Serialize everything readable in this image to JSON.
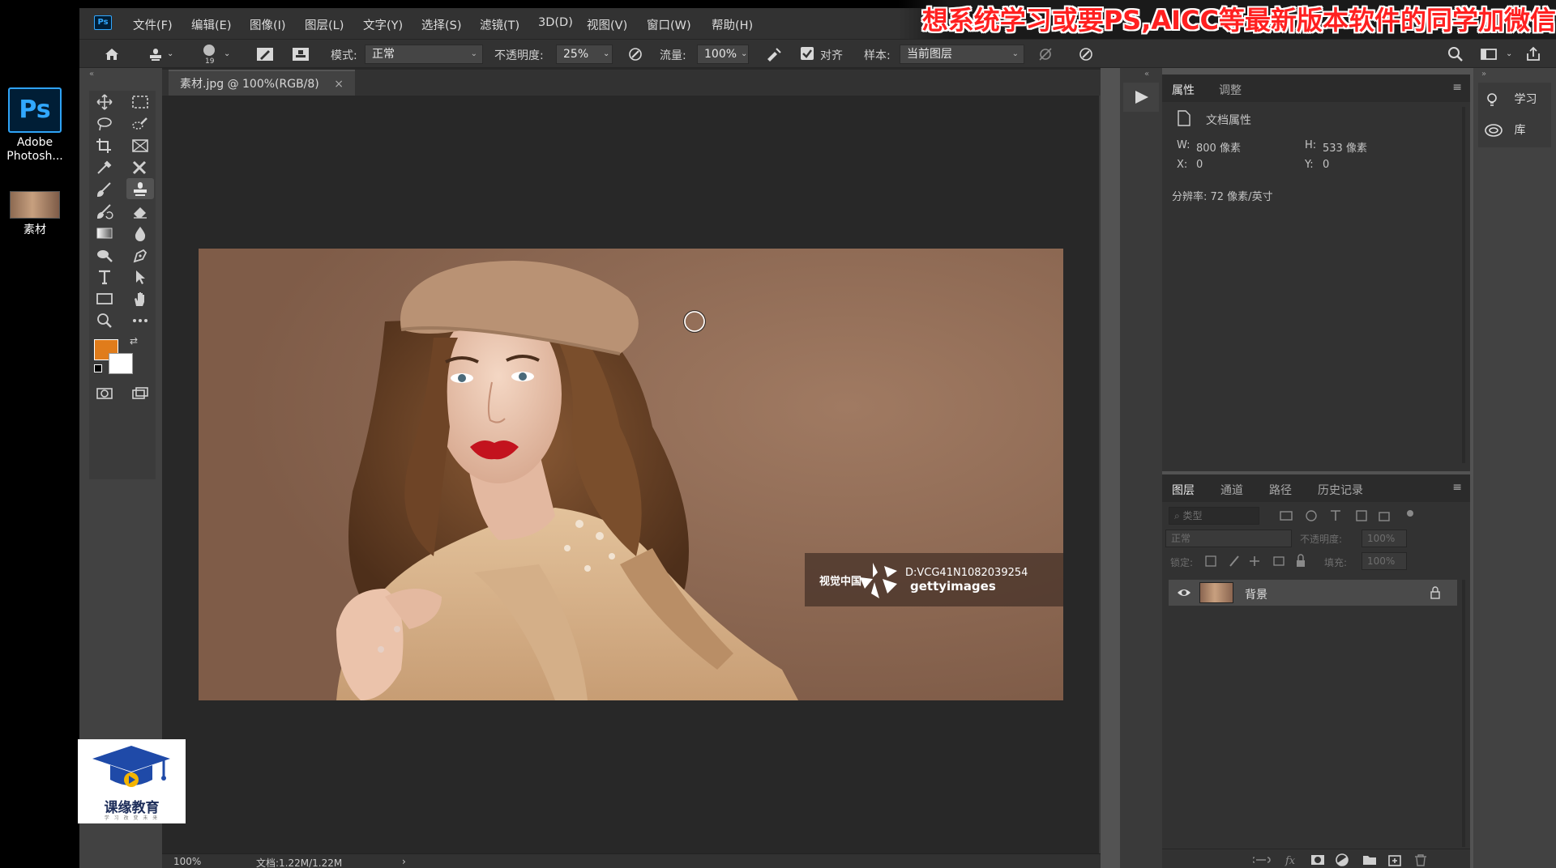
{
  "banner": {
    "text": "想系统学习或要PS,AICC等最新版本软件的同学加微信"
  },
  "desktop": {
    "app_icon_label_1": "Adobe",
    "app_icon_label_2": "Photosh...",
    "app_icon_text": "Ps",
    "file_icon_label": "素材"
  },
  "menubar": {
    "badge": "Ps",
    "items": [
      "文件(F)",
      "编辑(E)",
      "图像(I)",
      "图层(L)",
      "文字(Y)",
      "选择(S)",
      "滤镜(T)",
      "3D(D)",
      "视图(V)",
      "窗口(W)",
      "帮助(H)"
    ]
  },
  "options": {
    "brush_size": "19",
    "mode_label": "模式:",
    "mode_value": "正常",
    "opacity_label": "不透明度:",
    "opacity_value": "25%",
    "flow_label": "流量:",
    "flow_value": "100%",
    "align_label": "对齐",
    "align_checked": true,
    "sample_label": "样本:",
    "sample_value": "当前图层"
  },
  "document": {
    "tab_title": "素材.jpg @ 100%(RGB/8)",
    "close_glyph": "×",
    "zoom": "100%",
    "doc_info": "文档:1.22M/1.22M",
    "status_arrow": "›"
  },
  "image": {
    "watermark_brand": "视觉中国",
    "watermark_id": "D:VCG41N1082039254",
    "watermark_source": "gettyimages"
  },
  "properties_panel": {
    "tabs": [
      "属性",
      "调整"
    ],
    "section": "文档属性",
    "w_label": "W:",
    "w_value": "800 像素",
    "h_label": "H:",
    "h_value": "533 像素",
    "x_label": "X:",
    "x_value": "0",
    "y_label": "Y:",
    "y_value": "0",
    "resolution": "分辨率: 72 像素/英寸"
  },
  "layers_panel": {
    "tabs": [
      "图层",
      "通道",
      "路径",
      "历史记录"
    ],
    "filter_placeholder": "类型",
    "blend_mode": "正常",
    "opacity_label": "不透明度:",
    "opacity_value": "100%",
    "lock_label": "锁定:",
    "fill_label": "填充:",
    "fill_value": "100%",
    "layers": [
      {
        "name": "背景",
        "visible": true,
        "locked": true
      }
    ]
  },
  "learn_panel": {
    "items": [
      "学习",
      "库"
    ]
  },
  "edu_logo": {
    "name": "课缘教育",
    "tagline": "学 习 改 变 未 来"
  },
  "colors": {
    "foreground": "#e07c1b",
    "background": "#ffffff",
    "banner_text": "#ff2020",
    "ps_blue": "#31a8ff"
  }
}
